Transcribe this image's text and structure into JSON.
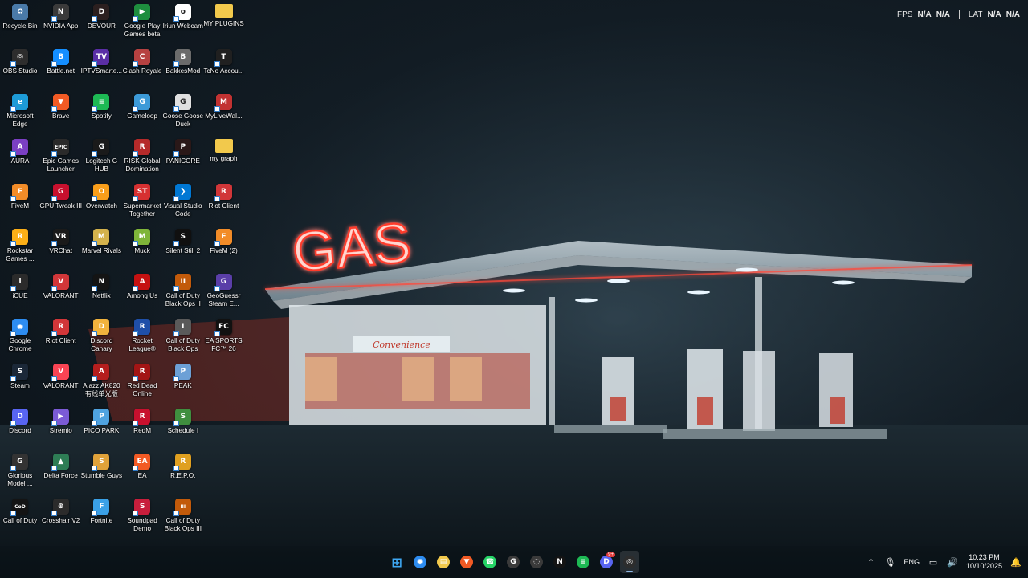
{
  "wallpaper": {
    "sign_text": "GAS",
    "store_sign": "Convenience"
  },
  "overlay": {
    "fps_label": "FPS",
    "fps_value1": "N/A",
    "fps_value2": "N/A",
    "lat_label": "LAT",
    "lat_value1": "N/A",
    "lat_value2": "N/A"
  },
  "desktop": {
    "icons": [
      {
        "label": "Recycle Bin",
        "color": "#4a7aa8",
        "glyph": "♻",
        "arrow": false
      },
      {
        "label": "NVIDIA App",
        "color": "#3a3a3a",
        "glyph": "N",
        "arrow": true
      },
      {
        "label": "DEVOUR",
        "color": "#2b1f1f",
        "glyph": "D",
        "arrow": true
      },
      {
        "label": "Google Play Games beta",
        "color": "#1e8e3e",
        "glyph": "▶",
        "arrow": true
      },
      {
        "label": "Iriun Webcam",
        "color": "#ffffff",
        "glyph": "o",
        "arrow": true
      },
      {
        "label": "MY PLUGINS",
        "color": "#f2c94c",
        "glyph": "",
        "arrow": false
      },
      {
        "label": "OBS Studio",
        "color": "#2d2d2d",
        "glyph": "◎",
        "arrow": true
      },
      {
        "label": "Battle.net",
        "color": "#148eff",
        "glyph": "B",
        "arrow": true
      },
      {
        "label": "IPTVSmarte...",
        "color": "#5a2ea6",
        "glyph": "TV",
        "arrow": true
      },
      {
        "label": "Clash Royale",
        "color": "#b64141",
        "glyph": "C",
        "arrow": true
      },
      {
        "label": "BakkesMod",
        "color": "#6b6b6b",
        "glyph": "B",
        "arrow": true
      },
      {
        "label": "TcNo Accou...",
        "color": "#202020",
        "glyph": "T",
        "arrow": true
      },
      {
        "label": "Microsoft Edge",
        "color": "#1d9bd7",
        "glyph": "e",
        "arrow": true
      },
      {
        "label": "Brave",
        "color": "#f15a24",
        "glyph": "▼",
        "arrow": true
      },
      {
        "label": "Spotify",
        "color": "#1db954",
        "glyph": "≡",
        "arrow": true
      },
      {
        "label": "Gameloop",
        "color": "#3c9ad8",
        "glyph": "G",
        "arrow": true
      },
      {
        "label": "Goose Goose Duck",
        "color": "#e0e0e0",
        "glyph": "G",
        "arrow": true
      },
      {
        "label": "MyLiveWal...",
        "color": "#c23232",
        "glyph": "M",
        "arrow": true
      },
      {
        "label": "AURA",
        "color": "#7b3fc4",
        "glyph": "A",
        "arrow": true
      },
      {
        "label": "Epic Games Launcher",
        "color": "#2a2a2a",
        "glyph": "EPIC",
        "arrow": true
      },
      {
        "label": "Logitech G HUB",
        "color": "#1a1a1a",
        "glyph": "G",
        "arrow": true
      },
      {
        "label": "RISK Global Domination",
        "color": "#b52a2a",
        "glyph": "R",
        "arrow": true
      },
      {
        "label": "PANICORE",
        "color": "#2a1818",
        "glyph": "P",
        "arrow": true
      },
      {
        "label": "my graph",
        "color": "#f2c94c",
        "glyph": "",
        "arrow": false
      },
      {
        "label": "FiveM",
        "color": "#f28c28",
        "glyph": "F",
        "arrow": true
      },
      {
        "label": "GPU Tweak III",
        "color": "#c8102e",
        "glyph": "G",
        "arrow": true
      },
      {
        "label": "Overwatch",
        "color": "#f99e1a",
        "glyph": "O",
        "arrow": true
      },
      {
        "label": "Supermarket Together",
        "color": "#d63031",
        "glyph": "ST",
        "arrow": true
      },
      {
        "label": "Visual Studio Code",
        "color": "#0078d4",
        "glyph": "❯",
        "arrow": true
      },
      {
        "label": "Riot Client",
        "color": "#d13639",
        "glyph": "R",
        "arrow": true
      },
      {
        "label": "Rockstar Games ...",
        "color": "#fcaf17",
        "glyph": "R",
        "arrow": true
      },
      {
        "label": "VRChat",
        "color": "#1a1a1a",
        "glyph": "VR",
        "arrow": true
      },
      {
        "label": "Marvel Rivals",
        "color": "#d4b24c",
        "glyph": "M",
        "arrow": true
      },
      {
        "label": "Muck",
        "color": "#7fb539",
        "glyph": "M",
        "arrow": true
      },
      {
        "label": "Silent Still 2",
        "color": "#101010",
        "glyph": "S",
        "arrow": true
      },
      {
        "label": "FiveM (2)",
        "color": "#f28c28",
        "glyph": "F",
        "arrow": true
      },
      {
        "label": "iCUE",
        "color": "#2b2b2b",
        "glyph": "i",
        "arrow": true
      },
      {
        "label": "VALORANT",
        "color": "#d13639",
        "glyph": "V",
        "arrow": true
      },
      {
        "label": "Netflix",
        "color": "#141414",
        "glyph": "N",
        "arrow": true
      },
      {
        "label": "Among Us",
        "color": "#c51111",
        "glyph": "A",
        "arrow": true
      },
      {
        "label": "Call of Duty Black Ops II",
        "color": "#c25a0a",
        "glyph": "II",
        "arrow": true
      },
      {
        "label": "GeoGuessr Steam E...",
        "color": "#5a3ea8",
        "glyph": "G",
        "arrow": true
      },
      {
        "label": "Google Chrome",
        "color": "#2d8cf0",
        "glyph": "◉",
        "arrow": true
      },
      {
        "label": "Riot Client",
        "color": "#d13639",
        "glyph": "R",
        "arrow": true
      },
      {
        "label": "Discord Canary",
        "color": "#f2b33d",
        "glyph": "D",
        "arrow": true
      },
      {
        "label": "Rocket League®",
        "color": "#1f4fa8",
        "glyph": "R",
        "arrow": true
      },
      {
        "label": "Call of Duty Black Ops",
        "color": "#5a5a5a",
        "glyph": "I",
        "arrow": true
      },
      {
        "label": "EA SPORTS FC™ 26",
        "color": "#111111",
        "glyph": "FC",
        "arrow": true
      },
      {
        "label": "Steam",
        "color": "#1b2838",
        "glyph": "S",
        "arrow": true
      },
      {
        "label": "VALORANT",
        "color": "#fa4454",
        "glyph": "V",
        "arrow": true
      },
      {
        "label": "Ajazz AK820 有线单光版",
        "color": "#b51e1e",
        "glyph": "A",
        "arrow": true
      },
      {
        "label": "Red Dead Online",
        "color": "#a31515",
        "glyph": "R",
        "arrow": true
      },
      {
        "label": "PEAK",
        "color": "#6ca0d6",
        "glyph": "P",
        "arrow": true
      },
      {
        "label": "",
        "color": "",
        "glyph": "",
        "arrow": false
      },
      {
        "label": "Discord",
        "color": "#5865f2",
        "glyph": "D",
        "arrow": true
      },
      {
        "label": "Stremio",
        "color": "#7b5bd6",
        "glyph": "▶",
        "arrow": true
      },
      {
        "label": "PICO PARK",
        "color": "#4fa3e0",
        "glyph": "P",
        "arrow": true
      },
      {
        "label": "RedM",
        "color": "#c8102e",
        "glyph": "R",
        "arrow": true
      },
      {
        "label": "Schedule I",
        "color": "#3f8f3f",
        "glyph": "S",
        "arrow": true
      },
      {
        "label": "",
        "color": "",
        "glyph": "",
        "arrow": false
      },
      {
        "label": "Glorious Model ...",
        "color": "#333333",
        "glyph": "G",
        "arrow": true
      },
      {
        "label": "Delta Force",
        "color": "#2e7d55",
        "glyph": "▲",
        "arrow": true
      },
      {
        "label": "Stumble Guys",
        "color": "#e0a23a",
        "glyph": "S",
        "arrow": true
      },
      {
        "label": "EA",
        "color": "#f25a24",
        "glyph": "EA",
        "arrow": true
      },
      {
        "label": "R.E.P.O.",
        "color": "#e0a020",
        "glyph": "R",
        "arrow": true
      },
      {
        "label": "",
        "color": "",
        "glyph": "",
        "arrow": false
      },
      {
        "label": "Call of Duty",
        "color": "#141414",
        "glyph": "CoD",
        "arrow": true
      },
      {
        "label": "Crosshair V2",
        "color": "#2b2b2b",
        "glyph": "⊕",
        "arrow": true
      },
      {
        "label": "Fortnite",
        "color": "#3aa0e6",
        "glyph": "F",
        "arrow": true
      },
      {
        "label": "Soundpad Demo",
        "color": "#c81e3c",
        "glyph": "S",
        "arrow": true
      },
      {
        "label": "Call of Duty Black Ops III",
        "color": "#c25a0a",
        "glyph": "III",
        "arrow": true
      },
      {
        "label": "",
        "color": "",
        "glyph": "",
        "arrow": false
      }
    ]
  },
  "taskbar": {
    "apps": [
      {
        "name": "start-button",
        "color": "#3fa9f5",
        "glyph": "⊞",
        "active": false
      },
      {
        "name": "chrome-app",
        "color": "#2d8cf0",
        "glyph": "◉",
        "active": false
      },
      {
        "name": "file-explorer-app",
        "color": "#f2c94c",
        "glyph": "▤",
        "active": false
      },
      {
        "name": "brave-app",
        "color": "#f15a24",
        "glyph": "▼",
        "active": false
      },
      {
        "name": "whatsapp-app",
        "color": "#25d366",
        "glyph": "☎",
        "active": false
      },
      {
        "name": "logitech-app",
        "color": "#3a3a3a",
        "glyph": "G",
        "active": false
      },
      {
        "name": "crosshair-app",
        "color": "#3a3a3a",
        "glyph": "◌",
        "active": false
      },
      {
        "name": "netflix-app",
        "color": "#141414",
        "glyph": "N",
        "active": false
      },
      {
        "name": "spotify-app",
        "color": "#1db954",
        "glyph": "≡",
        "active": false
      },
      {
        "name": "discord-app",
        "color": "#5865f2",
        "glyph": "D",
        "active": false,
        "badge": "9+"
      },
      {
        "name": "obs-app",
        "color": "#2d2d2d",
        "glyph": "◎",
        "active": true
      }
    ],
    "tray": {
      "language": "ENG",
      "time": "10:23 PM",
      "date": "10/10/2025"
    }
  }
}
